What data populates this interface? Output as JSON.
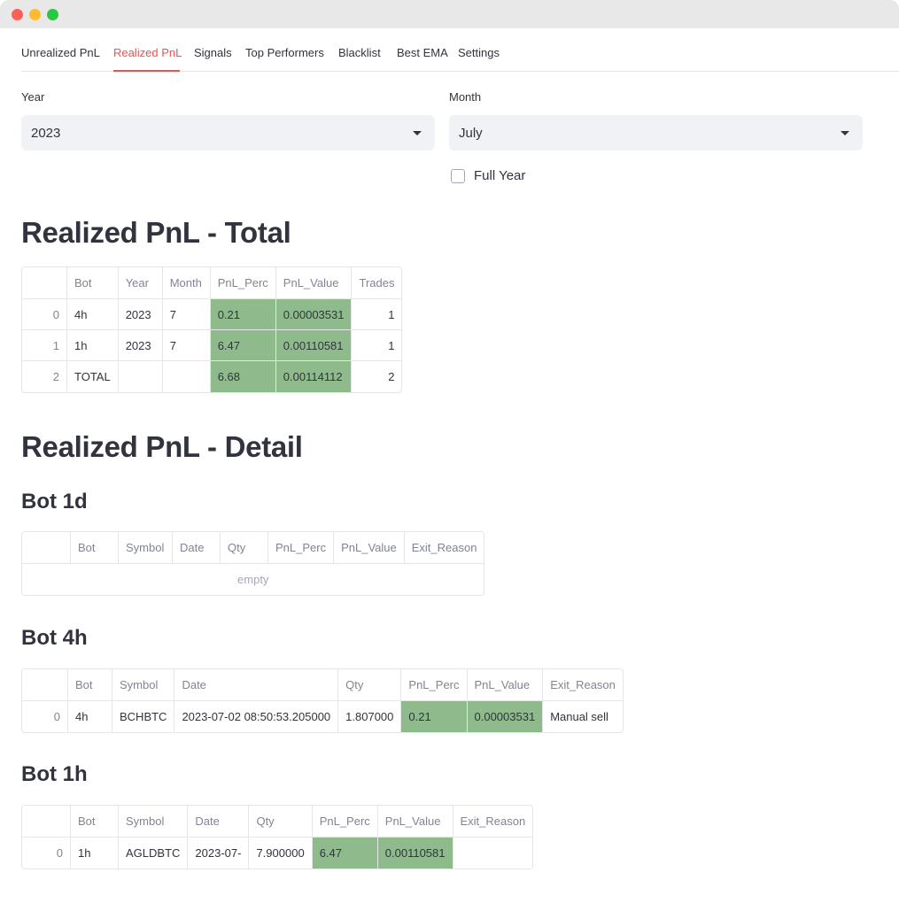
{
  "tabs": [
    {
      "label": "Unrealized PnL",
      "active": false
    },
    {
      "label": "Realized PnL",
      "active": true
    },
    {
      "label": "Signals",
      "active": false
    },
    {
      "label": "Top Performers",
      "active": false
    },
    {
      "label": "Blacklist",
      "active": false
    },
    {
      "label": "Best EMA",
      "active": false
    },
    {
      "label": "Settings",
      "active": false
    }
  ],
  "filters": {
    "year_label": "Year",
    "year_value": "2023",
    "month_label": "Month",
    "month_value": "July",
    "full_year_label": "Full Year",
    "full_year_checked": false
  },
  "colors": {
    "accent": "#ff4b4b",
    "highlight": "#8fbb8c"
  },
  "total": {
    "title": "Realized PnL - Total",
    "headers": [
      "",
      "Bot",
      "Year",
      "Month",
      "PnL_Perc",
      "PnL_Value",
      "Trades"
    ],
    "rows": [
      [
        "0",
        "4h",
        "2023",
        "7",
        "0.21",
        "0.00003531",
        "1"
      ],
      [
        "1",
        "1h",
        "2023",
        "7",
        "6.47",
        "0.00110581",
        "1"
      ],
      [
        "2",
        "TOTAL",
        "",
        "",
        "6.68",
        "0.00114112",
        "2"
      ]
    ]
  },
  "detail": {
    "title": "Realized PnL - Detail",
    "bot_1d": {
      "title": "Bot 1d",
      "headers": [
        "",
        "Bot",
        "Symbol",
        "Date",
        "Qty",
        "PnL_Perc",
        "PnL_Value",
        "Exit_Reason"
      ],
      "empty_text": "empty"
    },
    "bot_4h": {
      "title": "Bot 4h",
      "headers": [
        "",
        "Bot",
        "Symbol",
        "Date",
        "Qty",
        "PnL_Perc",
        "PnL_Value",
        "Exit_Reason"
      ],
      "rows": [
        [
          "0",
          "4h",
          "BCHBTC",
          "2023-07-02 08:50:53.205000",
          "1.807000",
          "0.21",
          "0.00003531",
          "Manual sell"
        ]
      ]
    },
    "bot_1h": {
      "title": "Bot 1h",
      "headers": [
        "",
        "Bot",
        "Symbol",
        "Date",
        "Qty",
        "PnL_Perc",
        "PnL_Value",
        "Exit_Reason"
      ],
      "rows": [
        [
          "0",
          "1h",
          "AGLDBTC",
          "2023-07-",
          "7.900000",
          "6.47",
          "0.00110581",
          ""
        ]
      ]
    }
  }
}
